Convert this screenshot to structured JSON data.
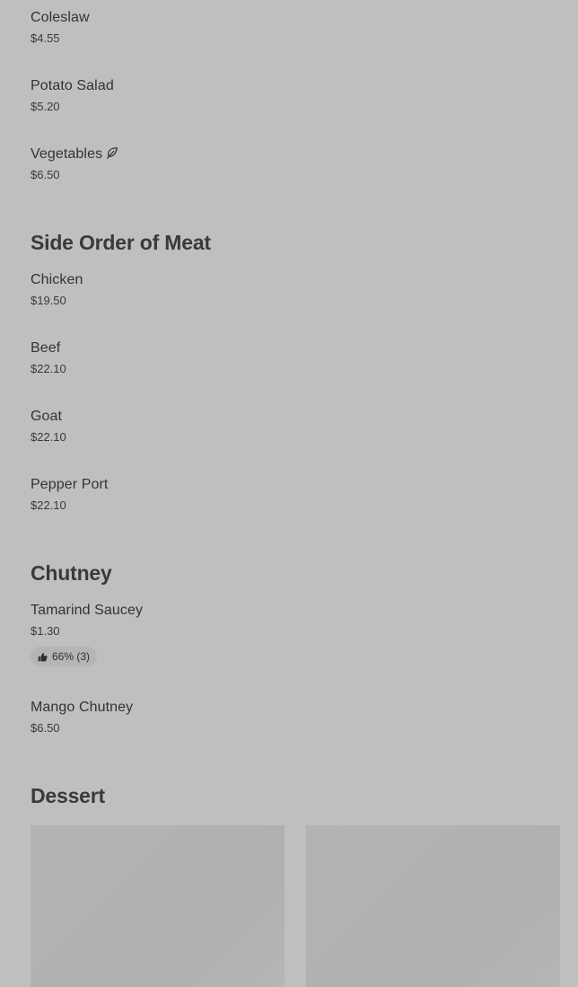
{
  "sections": {
    "sides": {
      "items": [
        {
          "name": "Coleslaw",
          "price": "$4.55"
        },
        {
          "name": "Potato Salad",
          "price": "$5.20"
        },
        {
          "name": "Vegetables",
          "price": "$6.50",
          "icon": "leaf-icon"
        }
      ]
    },
    "meat": {
      "title": "Side Order of Meat",
      "items": [
        {
          "name": "Chicken",
          "price": "$19.50"
        },
        {
          "name": "Beef",
          "price": "$22.10"
        },
        {
          "name": "Goat",
          "price": "$22.10"
        },
        {
          "name": "Pepper Port",
          "price": "$22.10"
        }
      ]
    },
    "chutney": {
      "title": "Chutney",
      "items": [
        {
          "name": "Tamarind Saucey",
          "price": "$1.30",
          "rating": "66% (3)",
          "rating_icon": "thumbs-up-icon"
        },
        {
          "name": "Mango Chutney",
          "price": "$6.50"
        }
      ]
    },
    "dessert": {
      "title": "Dessert"
    }
  }
}
